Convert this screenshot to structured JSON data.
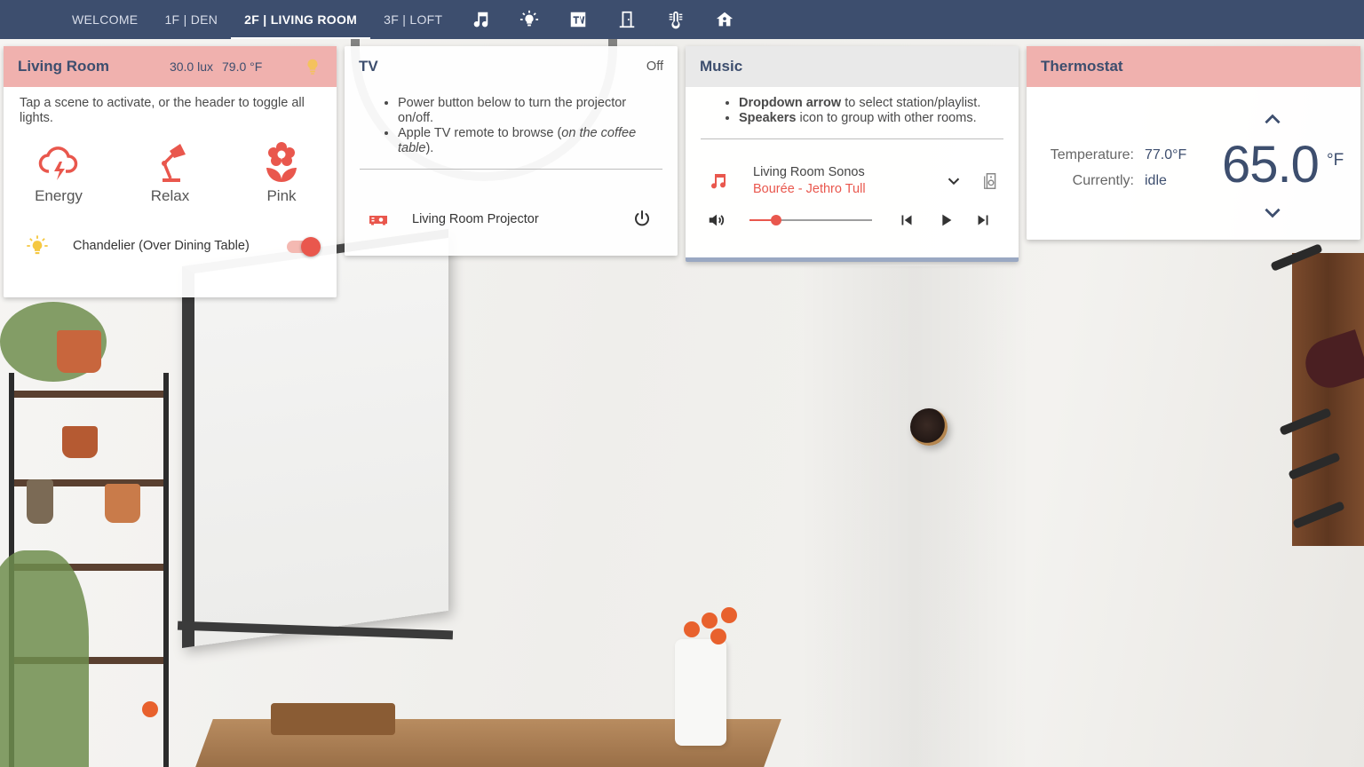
{
  "nav": {
    "tabs": [
      {
        "label": "WELCOME"
      },
      {
        "label": "1F | DEN"
      },
      {
        "label": "2F | LIVING ROOM"
      },
      {
        "label": "3F | LOFT"
      }
    ],
    "active_tab": "2F | LIVING ROOM",
    "icons": [
      "music-note-icon",
      "lightbulb-icon",
      "tv-icon",
      "door-icon",
      "thermometer-icon",
      "home-icon"
    ]
  },
  "living_room": {
    "title": "Living Room",
    "lux": "30.0 lux",
    "temp": "79.0 °F",
    "description": "Tap a scene to activate, or the header to toggle all lights.",
    "scenes": [
      {
        "label": "Energy",
        "icon": "cloud-bolt-icon"
      },
      {
        "label": "Relax",
        "icon": "desk-lamp-icon"
      },
      {
        "label": "Pink",
        "icon": "flower-icon"
      }
    ],
    "light": {
      "name": "Chandelier (Over Dining Table)",
      "state": "on"
    }
  },
  "tv": {
    "title": "TV",
    "state": "Off",
    "bullets": [
      {
        "text": "Power button below to turn the projector on/off."
      },
      {
        "text_before": "Apple TV remote to browse (",
        "italic": "on the coffee table",
        "text_after": ")."
      }
    ],
    "entity": "Living Room Projector"
  },
  "music": {
    "title": "Music",
    "bullets": [
      {
        "bold": "Dropdown arrow",
        "text": " to select station/playlist."
      },
      {
        "bold": "Speakers",
        "text": " icon to group with other rooms."
      }
    ],
    "player": {
      "name": "Living Room Sonos",
      "track": "Bourée - Jethro Tull",
      "volume": 0.22
    }
  },
  "thermostat": {
    "title": "Thermostat",
    "temperature_label": "Temperature:",
    "temperature_value": "77.0°F",
    "currently_label": "Currently:",
    "currently_value": "idle",
    "target": "65.0",
    "unit": "°F"
  },
  "colors": {
    "nav_bg": "#3d4e6e",
    "accent": "#e9574d",
    "header_pink": "#f0b1ae",
    "text_primary": "#3d4e6e"
  }
}
